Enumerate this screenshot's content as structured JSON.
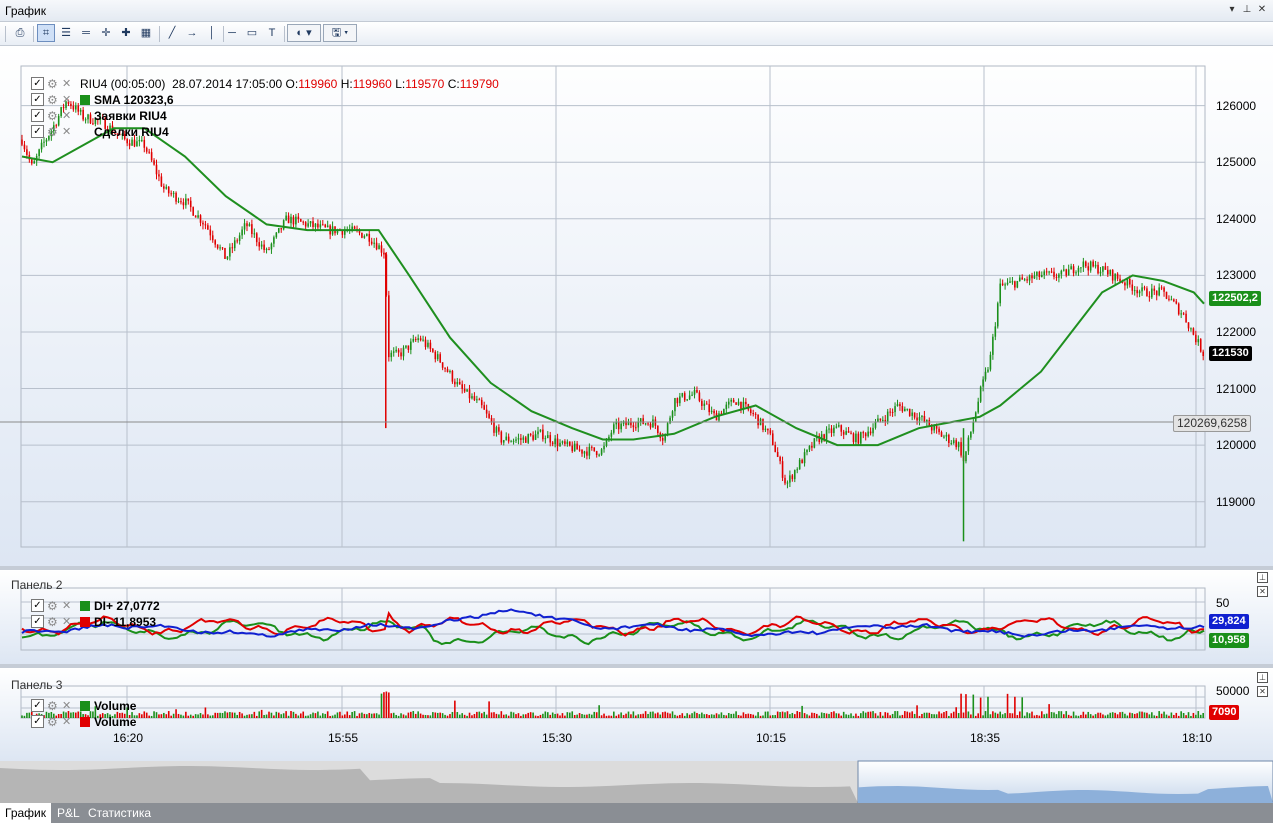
{
  "window": {
    "title": "График"
  },
  "toolbar": {
    "icons": [
      "print-icon",
      "chart-select-icon",
      "list-icon",
      "hline-icon",
      "crosshair-icon",
      "add-object-icon",
      "grid-icon",
      "line-tool-icon",
      "arrow-tool-icon",
      "vline-tool-icon",
      "hline-tool-icon",
      "rect-tool-icon",
      "text-tool-icon",
      "color-picker-icon",
      "save-icon"
    ]
  },
  "panel1": {
    "legend": {
      "instrument": "RIU4 (00:05:00)",
      "datetime": "28.07.2014 17:05:00",
      "o_label": "O:",
      "o_val": "119960",
      "h_label": "H:",
      "h_val": "119960",
      "l_label": "L:",
      "l_val": "119570",
      "c_label": "C:",
      "c_val": "119790",
      "sma": "SMA  120323,6",
      "orders": "Заявки RIU4",
      "trades": "Сделки RIU4"
    },
    "y_ticks": [
      "126000",
      "125000",
      "124000",
      "123000",
      "122000",
      "121000",
      "120000",
      "119000"
    ],
    "sma_label": "122502,2",
    "last_label": "121530",
    "cursor_label": "120269,6258",
    "colors": {
      "up": "#1a8f1a",
      "down": "#e00000",
      "sma": "#1f8f1f"
    }
  },
  "panel2": {
    "title": "Панель 2",
    "di_plus": "DI+  27,0772",
    "di_minus": "DI-  11,8953",
    "y_tick": "50",
    "blue_label": "29,824",
    "green_label": "10,958"
  },
  "panel3": {
    "title": "Панель 3",
    "vol1": "Volume",
    "vol2": "Volume",
    "y_tick": "50000",
    "vol_label": "7090"
  },
  "x_axis": [
    "16:20",
    "15:55",
    "15:30",
    "10:15",
    "18:35",
    "18:10"
  ],
  "tabs": [
    "График",
    "P&L",
    "Статистика"
  ],
  "chart_data": {
    "type": "candlestick",
    "title": "RIU4 (00:05:00)",
    "ylim": [
      118200,
      126700
    ],
    "series": [
      {
        "name": "SMA",
        "last": 120323.6
      },
      {
        "name": "DI+",
        "last": 27.0772
      },
      {
        "name": "DI-",
        "last": 11.8953
      },
      {
        "name": "Volume",
        "last": 7090
      }
    ],
    "price_path": [
      [
        0,
        125400
      ],
      [
        5,
        124900
      ],
      [
        10,
        125300
      ],
      [
        15,
        125600
      ],
      [
        22,
        126100
      ],
      [
        30,
        125800
      ],
      [
        40,
        125700
      ],
      [
        50,
        125400
      ],
      [
        60,
        125300
      ],
      [
        70,
        124500
      ],
      [
        80,
        124300
      ],
      [
        90,
        123900
      ],
      [
        100,
        123300
      ],
      [
        110,
        123900
      ],
      [
        120,
        123400
      ],
      [
        130,
        124000
      ],
      [
        140,
        123900
      ],
      [
        150,
        123800
      ],
      [
        160,
        123800
      ],
      [
        170,
        123700
      ],
      [
        178,
        123400
      ],
      [
        180,
        121600
      ],
      [
        185,
        121600
      ],
      [
        195,
        121900
      ],
      [
        205,
        121500
      ],
      [
        215,
        121000
      ],
      [
        225,
        120700
      ],
      [
        235,
        120100
      ],
      [
        245,
        120100
      ],
      [
        255,
        120200
      ],
      [
        265,
        120000
      ],
      [
        275,
        119900
      ],
      [
        285,
        119900
      ],
      [
        290,
        120300
      ],
      [
        300,
        120400
      ],
      [
        310,
        120400
      ],
      [
        315,
        120100
      ],
      [
        320,
        120800
      ],
      [
        330,
        120900
      ],
      [
        340,
        120500
      ],
      [
        350,
        120800
      ],
      [
        360,
        120500
      ],
      [
        368,
        120100
      ],
      [
        375,
        119300
      ],
      [
        380,
        119600
      ],
      [
        390,
        120100
      ],
      [
        400,
        120300
      ],
      [
        410,
        120100
      ],
      [
        420,
        120400
      ],
      [
        430,
        120700
      ],
      [
        440,
        120500
      ],
      [
        450,
        120200
      ],
      [
        460,
        120000
      ],
      [
        462,
        119700
      ],
      [
        470,
        120900
      ],
      [
        475,
        121500
      ],
      [
        480,
        122800
      ],
      [
        490,
        122900
      ],
      [
        500,
        123000
      ],
      [
        510,
        123000
      ],
      [
        520,
        123200
      ],
      [
        530,
        123100
      ],
      [
        540,
        122900
      ],
      [
        550,
        122700
      ],
      [
        560,
        122700
      ],
      [
        570,
        122300
      ],
      [
        580,
        121600
      ]
    ],
    "sma_path": [
      [
        0,
        125100
      ],
      [
        15,
        125000
      ],
      [
        30,
        125300
      ],
      [
        45,
        125600
      ],
      [
        60,
        125600
      ],
      [
        80,
        125100
      ],
      [
        100,
        124400
      ],
      [
        120,
        123900
      ],
      [
        140,
        123800
      ],
      [
        160,
        123800
      ],
      [
        175,
        123800
      ],
      [
        190,
        123000
      ],
      [
        210,
        121900
      ],
      [
        230,
        121100
      ],
      [
        250,
        120600
      ],
      [
        270,
        120300
      ],
      [
        285,
        120100
      ],
      [
        300,
        120100
      ],
      [
        320,
        120200
      ],
      [
        340,
        120500
      ],
      [
        360,
        120700
      ],
      [
        380,
        120300
      ],
      [
        400,
        120000
      ],
      [
        420,
        120000
      ],
      [
        440,
        120300
      ],
      [
        455,
        120400
      ],
      [
        470,
        120500
      ],
      [
        480,
        120700
      ],
      [
        500,
        121300
      ],
      [
        515,
        122000
      ],
      [
        530,
        122700
      ],
      [
        545,
        123000
      ],
      [
        560,
        122900
      ],
      [
        575,
        122700
      ],
      [
        580,
        122500
      ]
    ]
  }
}
